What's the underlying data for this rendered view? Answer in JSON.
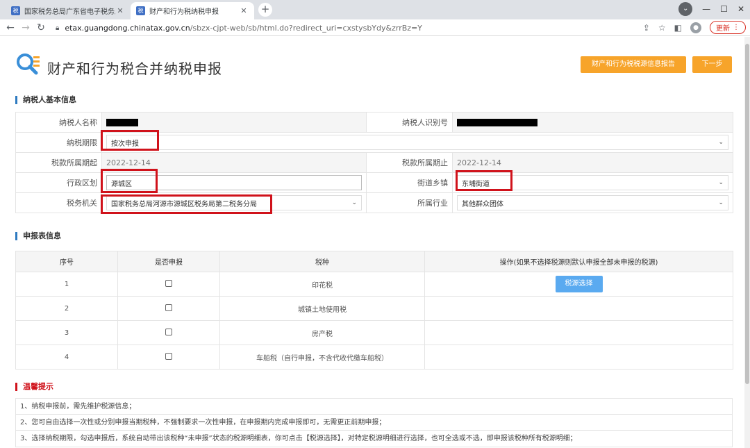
{
  "browser": {
    "tabs": [
      {
        "title": "国家税务总局广东省电子税务局"
      },
      {
        "title": "财产和行为税纳税申报"
      }
    ],
    "url_domain": "etax.guangdong.chinatax.gov.cn",
    "url_path": "/sbzx-cjpt-web/sb/html.do?redirect_uri=cxstysbYdy&zrrBz=Y",
    "update_label": "更新"
  },
  "header": {
    "title": "财产和行为税合并纳税申报",
    "report_button": "财产和行为税税源信息报告",
    "next_button": "下一步"
  },
  "basic_info": {
    "section_title": "纳税人基本信息",
    "taxpayer_name_label": "纳税人名称",
    "taxpayer_id_label": "纳税人识别号",
    "period_label": "纳税期限",
    "period_value": "按次申报",
    "start_label": "税款所属期起",
    "start_value": "2022-12-14",
    "end_label": "税款所属期止",
    "end_value": "2022-12-14",
    "district_label": "行政区划",
    "district_value": "源城区",
    "street_label": "街道乡镇",
    "street_value": "东埔街道",
    "authority_label": "税务机关",
    "authority_value": "国家税务总局河源市源城区税务局第二税务分局",
    "industry_label": "所属行业",
    "industry_value": "其他群众团体"
  },
  "declaration": {
    "section_title": "申报表信息",
    "headers": [
      "序号",
      "是否申报",
      "税种",
      "操作(如果不选择税源则默认申报全部未申报的税源)"
    ],
    "rows": [
      {
        "no": "1",
        "tax": "印花税"
      },
      {
        "no": "2",
        "tax": "城镇土地使用税"
      },
      {
        "no": "3",
        "tax": "房产税"
      },
      {
        "no": "4",
        "tax": "车船税（自行申报，不含代收代缴车船税）"
      }
    ],
    "select_source_button": "税源选择"
  },
  "tips": {
    "section_title": "温馨提示",
    "items": [
      "1、纳税申报前，需先维护税源信息；",
      "2、您可自由选择一次性或分别申报当期税种，不强制要求一次性申报，在申报期内完成申报即可，无需更正前期申报；",
      "3、选择纳税期限，勾选申报后，系统自动带出该税种“未申报”状态的税源明细表，你可点击【税源选择】，对特定税源明细进行选择，也可全选或不选，即申报该税种所有税源明细；"
    ]
  },
  "colors": {
    "accent_orange": "#f7a42a",
    "accent_blue": "#5aaaf0",
    "highlight_red": "#d0121b",
    "section_bar_blue": "#2d7ac0"
  }
}
